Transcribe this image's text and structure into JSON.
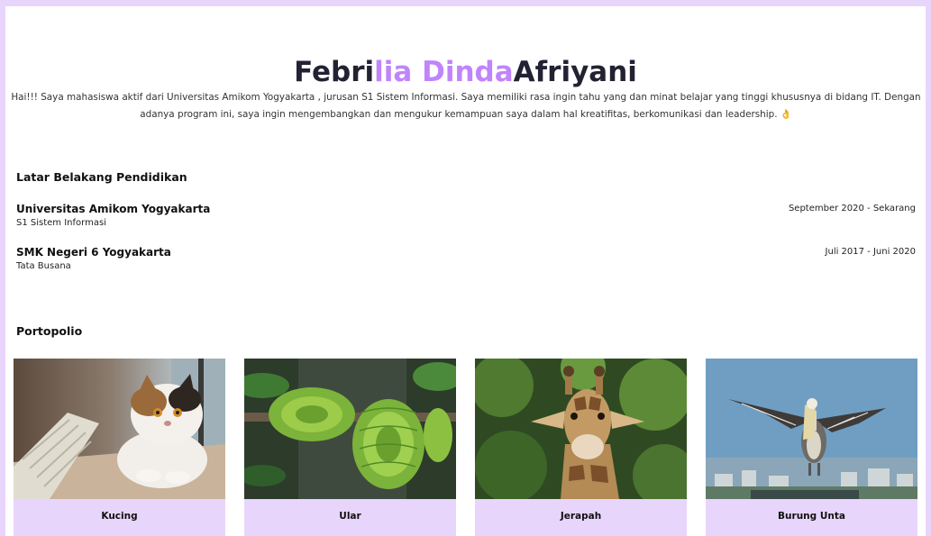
{
  "header": {
    "title_part1": "Febri",
    "title_part2": "lia Dinda",
    "title_part3": "Afriyani",
    "intro": "Hai!!! Saya mahasiswa aktif dari Universitas Amikom Yogyakarta , jurusan S1 Sistem Informasi. Saya memiliki rasa ingin tahu yang dan minat belajar yang tinggi khususnya di bidang IT. Dengan adanya program ini, saya ingin mengembangkan dan mengukur kemampuan saya dalam hal kreatifitas, berkomunikasi dan leadership. 👌"
  },
  "education": {
    "title": "Latar Belakang Pendidikan",
    "items": [
      {
        "school": "Universitas Amikom Yogyakarta",
        "major": "S1 Sistem Informasi",
        "period": "September 2020 - Sekarang"
      },
      {
        "school": "SMK Negeri 6 Yogyakarta",
        "major": "Tata Busana",
        "period": "Juli 2017 - Juni 2020"
      }
    ]
  },
  "portfolio": {
    "title": "Portopolio",
    "items": [
      {
        "caption": "Kucing",
        "image": "cat-photo"
      },
      {
        "caption": "Ular",
        "image": "snake-photo"
      },
      {
        "caption": "Jerapah",
        "image": "giraffe-photo"
      },
      {
        "caption": "Burung Unta",
        "image": "bird-photo"
      }
    ]
  },
  "colors": {
    "accent": "#c084fc",
    "frame": "#e8d5fb",
    "caption_bg": "#e8d5fb"
  }
}
